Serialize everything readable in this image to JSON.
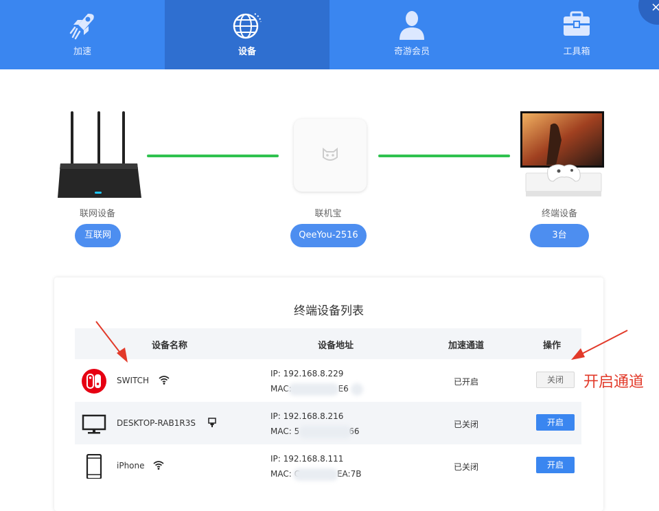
{
  "nav": {
    "tabs": [
      {
        "label": "加速",
        "icon": "rocket-icon"
      },
      {
        "label": "设备",
        "icon": "globe-icon"
      },
      {
        "label": "奇游会员",
        "icon": "user-icon"
      },
      {
        "label": "工具箱",
        "icon": "toolbox-icon"
      }
    ],
    "active_index": 1,
    "close_label": "×"
  },
  "topology": {
    "router": {
      "label": "联网设备",
      "button": "互联网"
    },
    "hub": {
      "label": "联机宝",
      "button": "QeeYou-2516"
    },
    "terminals": {
      "label": "终端设备",
      "button": "3台"
    }
  },
  "device_list": {
    "title": "终端设备列表",
    "columns": [
      "设备名称",
      "设备地址",
      "加速通道",
      "操作"
    ],
    "rows": [
      {
        "name": "SWITCH",
        "device_icon": "nintendo-switch-icon",
        "conn_icon": "wifi-icon",
        "ip": "IP: 192.168.8.229",
        "mac_prefix": "MAC: ",
        "mac_suffix": "E6",
        "status": "已开启",
        "action": "关闭"
      },
      {
        "name": "DESKTOP-RAB1R3S",
        "device_icon": "monitor-icon",
        "conn_icon": "ethernet-icon",
        "ip": "IP: 192.168.8.216",
        "mac_prefix": "MAC: 5",
        "mac_suffix": "66",
        "status": "已关闭",
        "action": "开启"
      },
      {
        "name": "iPhone",
        "device_icon": "phone-icon",
        "conn_icon": "wifi-icon",
        "ip": "IP: 192.168.8.111",
        "mac_prefix": "MAC: C",
        "mac_suffix": "EA:7B",
        "status": "已关闭",
        "action": "开启"
      }
    ]
  },
  "annotation": {
    "text": "开启通道",
    "color": "#e23a2a"
  },
  "colors": {
    "nav": "#3a86f0",
    "nav_active": "#2f6fd0",
    "accent": "#4d8ef0",
    "link_line": "#2fc24f"
  }
}
